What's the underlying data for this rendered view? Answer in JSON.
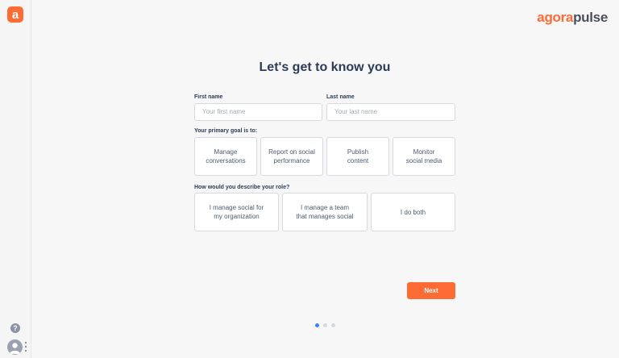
{
  "sidebar": {
    "logo_letter": "a",
    "help_label": "?"
  },
  "brand": {
    "part1": "agora",
    "part2": "pulse"
  },
  "page_title": "Let's get to know you",
  "form": {
    "first_name": {
      "label": "First name",
      "placeholder": "Your first name",
      "value": ""
    },
    "last_name": {
      "label": "Last name",
      "placeholder": "Your last name",
      "value": ""
    },
    "goal_question": "Your primary goal is to:",
    "goals": [
      {
        "label": "Manage\nconversations"
      },
      {
        "label": "Report on social\nperformance"
      },
      {
        "label": "Publish\ncontent"
      },
      {
        "label": "Monitor\nsocial media"
      }
    ],
    "role_question": "How would you describe your role?",
    "roles": [
      {
        "label": "I manage social for\nmy organization"
      },
      {
        "label": "I manage a team\nthat manages social"
      },
      {
        "label": "I do both"
      }
    ],
    "next_label": "Next"
  },
  "pagination": {
    "total": 3,
    "current": 1
  },
  "colors": {
    "accent": "#ff6b35",
    "active_dot": "#3b82f6",
    "title": "#2e3b57"
  }
}
